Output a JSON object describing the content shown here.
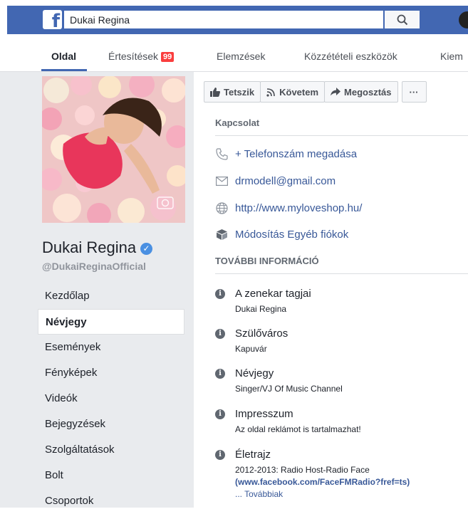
{
  "header": {
    "search_value": "Dukai Regina",
    "logo": "f"
  },
  "nav": {
    "tabs": [
      {
        "label": "Oldal"
      },
      {
        "label": "Értesítések"
      },
      {
        "label": "Elemzések"
      },
      {
        "label": "Közzétételi eszközök"
      },
      {
        "label": "Kiem"
      }
    ],
    "notif_count": "99"
  },
  "profile": {
    "name": "Dukai Regina",
    "handle": "@DukaiReginaOfficial",
    "verified_icon": "check-icon"
  },
  "sidebar": {
    "items": [
      {
        "label": "Kezdőlap"
      },
      {
        "label": "Névjegy"
      },
      {
        "label": "Események"
      },
      {
        "label": "Fényképek"
      },
      {
        "label": "Videók"
      },
      {
        "label": "Bejegyzések"
      },
      {
        "label": "Szolgáltatások"
      },
      {
        "label": "Bolt"
      },
      {
        "label": "Csoportok"
      }
    ]
  },
  "actions": {
    "like": "Tetszik",
    "follow": "Követem",
    "share": "Megosztás",
    "more": "···"
  },
  "contact": {
    "heading": "Kapcsolat",
    "phone": "+ Telefonszám megadása",
    "email": "drmodell@gmail.com",
    "website": "http://www.myloveshop.hu/",
    "other_accounts": "Módosítás Egyéb fiókok"
  },
  "more_info": {
    "heading": "TOVÁBBI INFORMÁCIÓ",
    "items": [
      {
        "title": "A zenekar tagjai",
        "value": "Dukai Regina"
      },
      {
        "title": "Szülőváros",
        "value": "Kapuvár"
      },
      {
        "title": "Névjegy",
        "value": "Singer/VJ Of Music Channel"
      },
      {
        "title": "Impresszum",
        "value": "Az oldal reklámot is tartalmazhat!"
      },
      {
        "title": "Életrajz",
        "value": "2012-2013: Radio Host-Radio Face",
        "link_open": "(",
        "link": "www.facebook.com/FaceFMRadio?fref=ts",
        "link_close": ")",
        "more": "... Továbbiak"
      }
    ]
  },
  "colors": {
    "brand": "#4267b2",
    "link": "#385898",
    "badge": "#fa3e3e"
  }
}
